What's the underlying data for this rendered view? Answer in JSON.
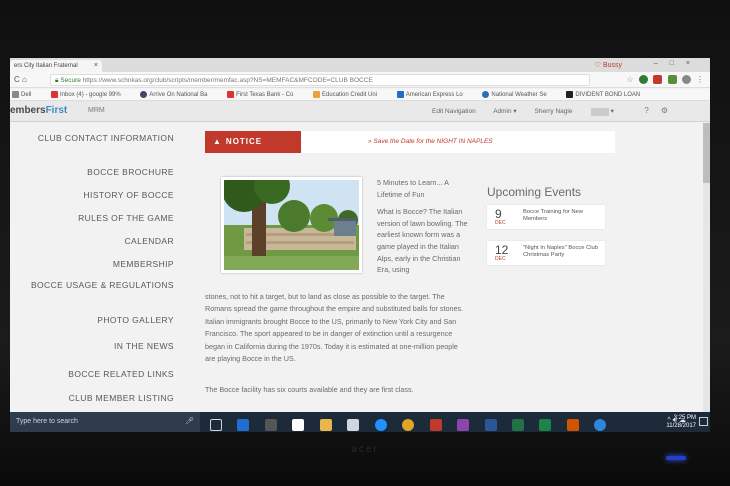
{
  "browser": {
    "tab_title": "ers City Italian Fraternal",
    "profile_name": "Bussy",
    "url_secure_label": "Secure",
    "url": "https://www.schnkas.org/club/scripts/member/memfac.asp?NS=MEMFAC&MFCODE=CLUB BOCCE",
    "bookmarks": [
      "Dell",
      "Inbox (4) - google 99%",
      "Arrive On National Ba",
      "First Texas Bank - Co",
      "Education Credit Uni",
      "American Express Lo",
      "National Weather Se",
      "DIVIDENT BOND LOAN"
    ]
  },
  "app": {
    "brand_prefix": "embers",
    "brand_suffix": "First",
    "section": "MRM",
    "edit_navigation": "Edit Navigation",
    "admin": "Admin ▾",
    "user": "Sherry Nagle"
  },
  "sidebar": {
    "items": [
      "CLUB CONTACT INFORMATION",
      "BOCCE BROCHURE",
      "HISTORY OF BOCCE",
      "RULES OF THE GAME",
      "CALENDAR",
      "MEMBERSHIP",
      "BOCCE USAGE & REGULATIONS",
      "PHOTO GALLERY",
      "IN THE NEWS",
      "BOCCE RELATED LINKS",
      "CLUB MEMBER LISTING"
    ]
  },
  "notice": {
    "label": "NOTICE",
    "message": "» Save the Date for the NIGHT IN NAPLES"
  },
  "article": {
    "headline": "5 Minutes to Learn... A Lifetime of Fun",
    "intro": "What is Bocce? The Italian version of lawn bowling. The earliest known form was a game played in the Italian Alps, early in the Christian Era, using",
    "body": "stones, not to hit a target, but to land as close as possible to the target. The Romans spread the game throughout the empire and substituted balls for stones. Italian immigrants brought Bocce to the US, primarily to New York City and San Francisco. The sport appeared to be in danger of extinction until a resurgence began in California during the 1970s. Today it is estimated at one-million people are playing Bocce in the US.",
    "facility": "The Bocce facility has six courts available and they are first class."
  },
  "events": {
    "heading": "Upcoming Events",
    "items": [
      {
        "day": "9",
        "month": "DEC",
        "title": "Bocce Training for New Members"
      },
      {
        "day": "12",
        "month": "DEC",
        "title": "\"Night In Naples\" Bocce Club Christmas Party"
      }
    ]
  },
  "taskbar": {
    "search_placeholder": "Type here to search",
    "time": "3:25 PM",
    "date": "11/28/2017"
  },
  "monitor": {
    "brand": "acer"
  }
}
